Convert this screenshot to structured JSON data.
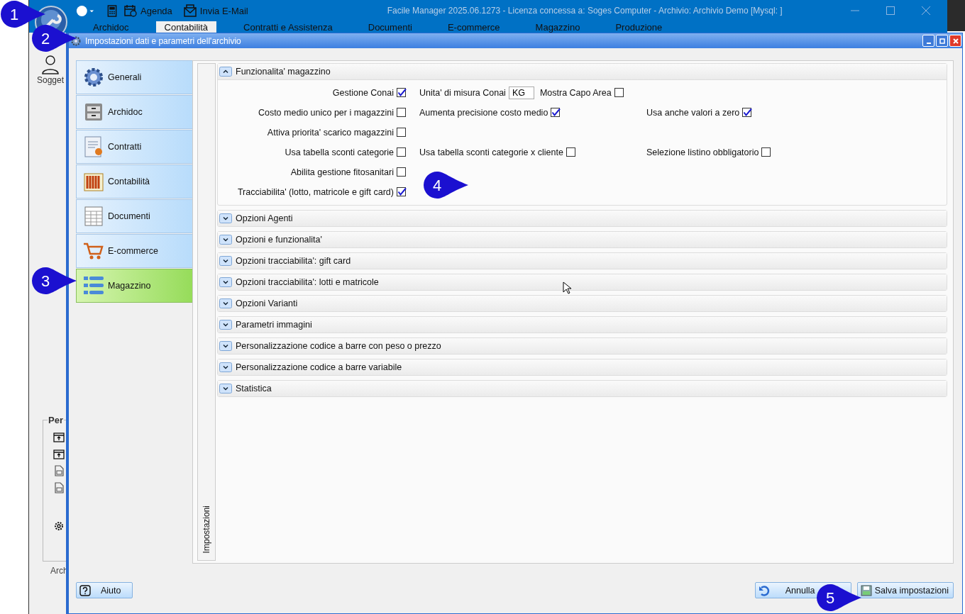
{
  "app": {
    "title": "Facile Manager 2025.06.1273 - Licenza concessa a: Soges Computer - Archivio: Archivio Demo  [Mysql: ]",
    "toolbar": [
      {
        "label": "Agenda",
        "kind": "calendar"
      },
      {
        "label": "Invia E-Mail",
        "kind": "mail"
      }
    ],
    "menu": [
      {
        "label": "Archidoc",
        "selected": false
      },
      {
        "label": "Contabilità",
        "selected": true
      },
      {
        "label": "Contratti e Assistenza",
        "selected": false
      },
      {
        "label": "Documenti",
        "selected": false
      },
      {
        "label": "E-commerce",
        "selected": false
      },
      {
        "label": "Magazzino",
        "selected": false
      },
      {
        "label": "Produzione",
        "selected": false
      }
    ],
    "side_label": "Sogget",
    "group_title": "Per",
    "footer_label": "Arch"
  },
  "dialog": {
    "title": "Impostazioni dati e parametri dell'archivio",
    "nav": [
      {
        "label": "Generali",
        "kind": "gear",
        "selected": false
      },
      {
        "label": "Archidoc",
        "kind": "cabinet",
        "selected": false
      },
      {
        "label": "Contratti",
        "kind": "certificate",
        "selected": false
      },
      {
        "label": "Contabilità",
        "kind": "books",
        "selected": false
      },
      {
        "label": "Documenti",
        "kind": "sheet",
        "selected": false
      },
      {
        "label": "E-commerce",
        "kind": "cart",
        "selected": false
      },
      {
        "label": "Magazzino",
        "kind": "list",
        "selected": true
      }
    ],
    "vertical_tab": "Impostazioni",
    "sections": [
      {
        "title": "Funzionalita' magazzino",
        "expanded": true,
        "rows": [
          [
            [
              {
                "kind": "checkbox",
                "label": "Gestione Conai",
                "checked": true
              }
            ],
            [
              {
                "kind": "field",
                "label": "Unita' di misura Conai",
                "value": "KG"
              },
              {
                "kind": "checkbox",
                "label": "Mostra Capo Area",
                "checked": false
              }
            ],
            []
          ],
          [
            [
              {
                "kind": "checkbox",
                "label": "Costo medio unico per i magazzini",
                "checked": false
              }
            ],
            [
              {
                "kind": "checkbox",
                "label": "Aumenta precisione costo medio",
                "checked": true
              }
            ],
            [
              {
                "kind": "checkbox",
                "label": "Usa anche valori a zero",
                "checked": true
              }
            ]
          ],
          [
            [
              {
                "kind": "checkbox",
                "label": "Attiva priorita' scarico magazzini",
                "checked": false
              }
            ],
            [],
            []
          ],
          [
            [
              {
                "kind": "checkbox",
                "label": "Usa tabella sconti categorie",
                "checked": false
              }
            ],
            [
              {
                "kind": "checkbox",
                "label": "Usa tabella sconti categorie x cliente",
                "checked": false
              }
            ],
            [
              {
                "kind": "checkbox",
                "label": "Selezione listino obbligatorio",
                "checked": false
              }
            ]
          ],
          [
            [
              {
                "kind": "checkbox",
                "label": "Abilita gestione fitosanitari",
                "checked": false
              }
            ],
            [],
            []
          ],
          [
            [
              {
                "kind": "checkbox",
                "label": "Tracciabilita' (lotto, matricole e gift card)",
                "checked": true
              }
            ],
            [],
            []
          ]
        ]
      },
      {
        "title": "Opzioni Agenti",
        "expanded": false
      },
      {
        "title": "Opzioni e funzionalita'",
        "expanded": false
      },
      {
        "title": "Opzioni tracciabilita': gift card",
        "expanded": false
      },
      {
        "title": "Opzioni tracciabilita': lotti e matricole",
        "expanded": false
      },
      {
        "title": "Opzioni Varianti",
        "expanded": false
      },
      {
        "title": "Parametri immagini",
        "expanded": false
      },
      {
        "title": "Personalizzazione codice a barre con peso o prezzo",
        "expanded": false
      },
      {
        "title": "Personalizzazione codice a barre variabile",
        "expanded": false
      },
      {
        "title": "Statistica",
        "expanded": false
      }
    ],
    "buttons": [
      {
        "label": "Aiuto",
        "kind": "help"
      },
      {
        "label": "Annulla",
        "kind": "undo"
      },
      {
        "label": "Salva impostazioni",
        "kind": "save"
      }
    ]
  },
  "callouts": [
    {
      "number": "1"
    },
    {
      "number": "2"
    },
    {
      "number": "3"
    },
    {
      "number": "4"
    },
    {
      "number": "5"
    }
  ]
}
